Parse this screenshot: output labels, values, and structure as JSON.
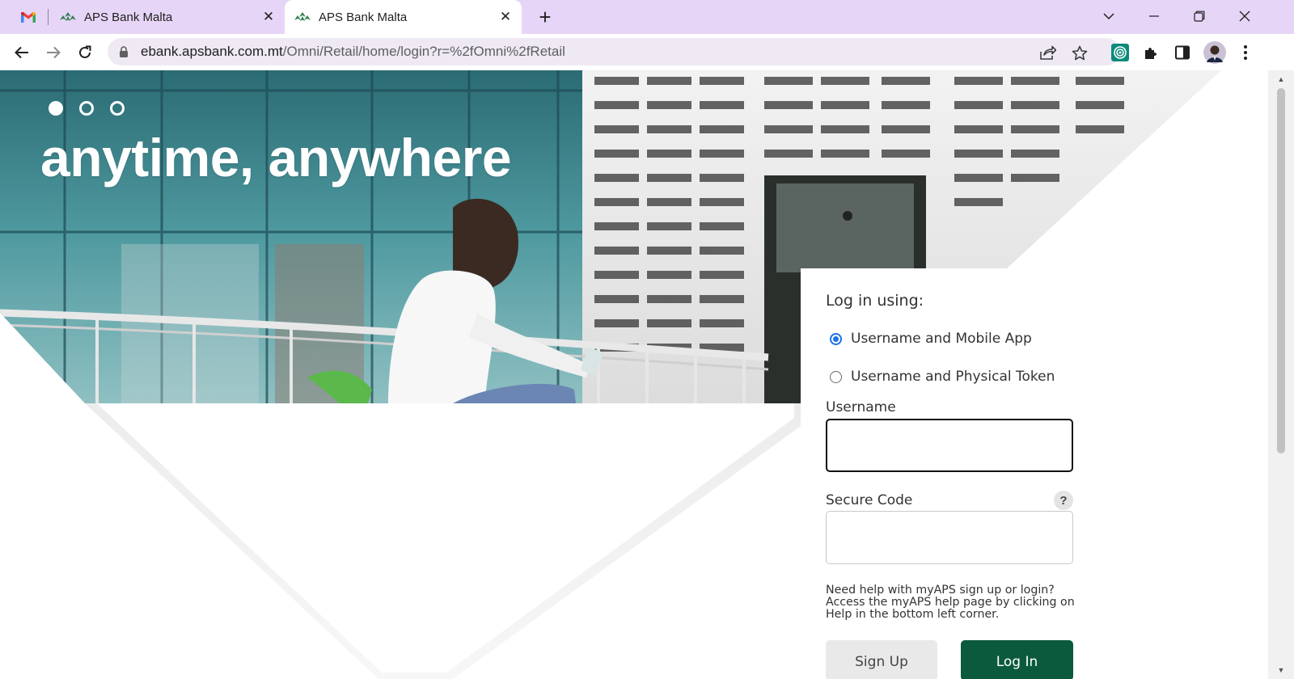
{
  "browser": {
    "tabs": [
      {
        "title": "APS Bank Malta",
        "active": false
      },
      {
        "title": "APS Bank Malta",
        "active": true
      }
    ],
    "url_host": "ebank.apsbank.com.mt",
    "url_path": "/Omni/Retail/home/login?r=%2fOmni%2fRetail",
    "colors": {
      "tabstrip": "#e7d5f7",
      "omnibox": "#efe9f4"
    }
  },
  "hero": {
    "tagline": "anytime, anywhere",
    "carousel_slides": 3,
    "active_slide": 1
  },
  "login": {
    "title": "Log in using:",
    "options": [
      {
        "label": "Username and Mobile App",
        "selected": true
      },
      {
        "label": "Username and Physical Token",
        "selected": false
      }
    ],
    "username_label": "Username",
    "username_value": "",
    "secure_code_label": "Secure Code",
    "secure_code_value": "",
    "help_icon_text": "?",
    "help_text": "Need help with myAPS sign up or login? Access the myAPS help page by clicking on Help in the bottom left corner.",
    "signup_label": "Sign Up",
    "login_label": "Log In",
    "colors": {
      "primary": "#0c5a3d",
      "radio_accent": "#1a73e8"
    }
  }
}
